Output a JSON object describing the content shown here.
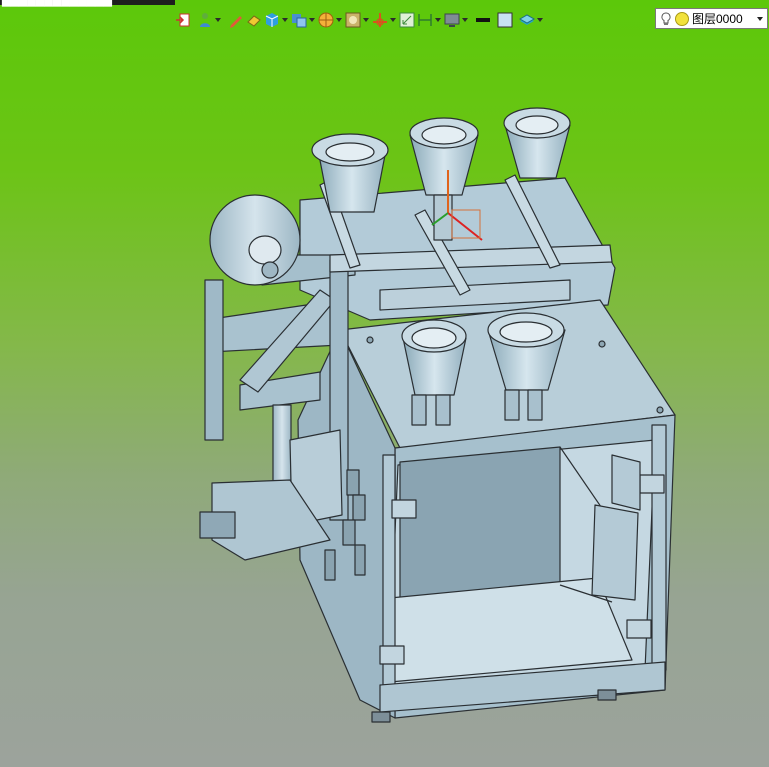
{
  "window": {
    "title_fragment": "█████████████"
  },
  "toolbar": {
    "items": [
      {
        "icon": "import-icon",
        "dropdown": false
      },
      {
        "icon": "person-icon",
        "dropdown": true
      },
      {
        "icon": "pencil-icon",
        "dropdown": false
      },
      {
        "icon": "eraser-icon",
        "dropdown": false
      },
      {
        "icon": "cube-icon",
        "dropdown": true
      },
      {
        "icon": "views-icon",
        "dropdown": true
      },
      {
        "icon": "section-icon",
        "dropdown": true
      },
      {
        "icon": "render-icon",
        "dropdown": true
      },
      {
        "icon": "axis-icon",
        "dropdown": true
      },
      {
        "icon": "fit-icon",
        "dropdown": false
      },
      {
        "icon": "dimension-icon",
        "dropdown": true
      },
      {
        "icon": "display-icon",
        "dropdown": true
      },
      {
        "icon": "line-width-icon",
        "dropdown": false
      },
      {
        "icon": "color-swatch-icon",
        "dropdown": false
      },
      {
        "icon": "layers-icon",
        "dropdown": true
      }
    ]
  },
  "layer_selector": {
    "value": "图层0000",
    "colors": {
      "bulb": "#f5e46a",
      "state": "#f2e23c"
    }
  },
  "viewport": {
    "background_top": "#5cc80a",
    "background_bottom": "#9ca39c",
    "model_color": "#a9c4d3",
    "edge_color": "#2a2f33"
  }
}
